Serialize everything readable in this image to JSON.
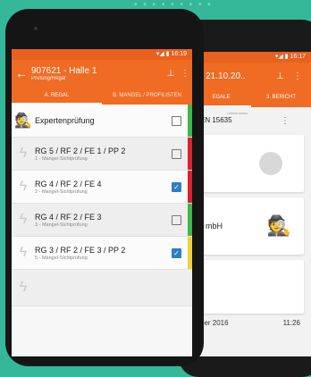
{
  "front": {
    "status_time": "16:19",
    "title": "907621 - Halle 1",
    "subtitle": "Prüfung/Regal",
    "tabs": [
      "A. REGAL",
      "B. MÄNGEL / PROFILISTEN"
    ],
    "items": [
      {
        "title": "Expertenprüfung",
        "sub": "",
        "checked": false,
        "bar": "#3db84a"
      },
      {
        "title": "RG 5 / RF 2 / FE 1 / PP 2",
        "sub": "1 - Mangel-Sichtprüfung",
        "checked": false,
        "bar": "#d9232e"
      },
      {
        "title": "RG 4  / RF 2 / FE 4",
        "sub": "2 - Mangel-Sichtprüfung",
        "checked": true,
        "bar": "#d9232e"
      },
      {
        "title": "RG 4  / RF 2 / FE 3",
        "sub": "3 - Mangel-Sichtprüfung",
        "checked": false,
        "bar": "#3db84a"
      },
      {
        "title": "RG 3 / RF 2 / FE 3 / PP 2",
        "sub": "5 - Mangel-Sichtprüfung",
        "checked": true,
        "bar": "#f2d23c"
      }
    ]
  },
  "back": {
    "status_time": "16:17",
    "title": "- 21.10.20..",
    "tabs": [
      "EGALE",
      "3. BERICHT"
    ],
    "line1": "EN 15635",
    "small": "Leitern lesen",
    "company": "mbH",
    "date": "ber 2016",
    "time": "11:26"
  }
}
